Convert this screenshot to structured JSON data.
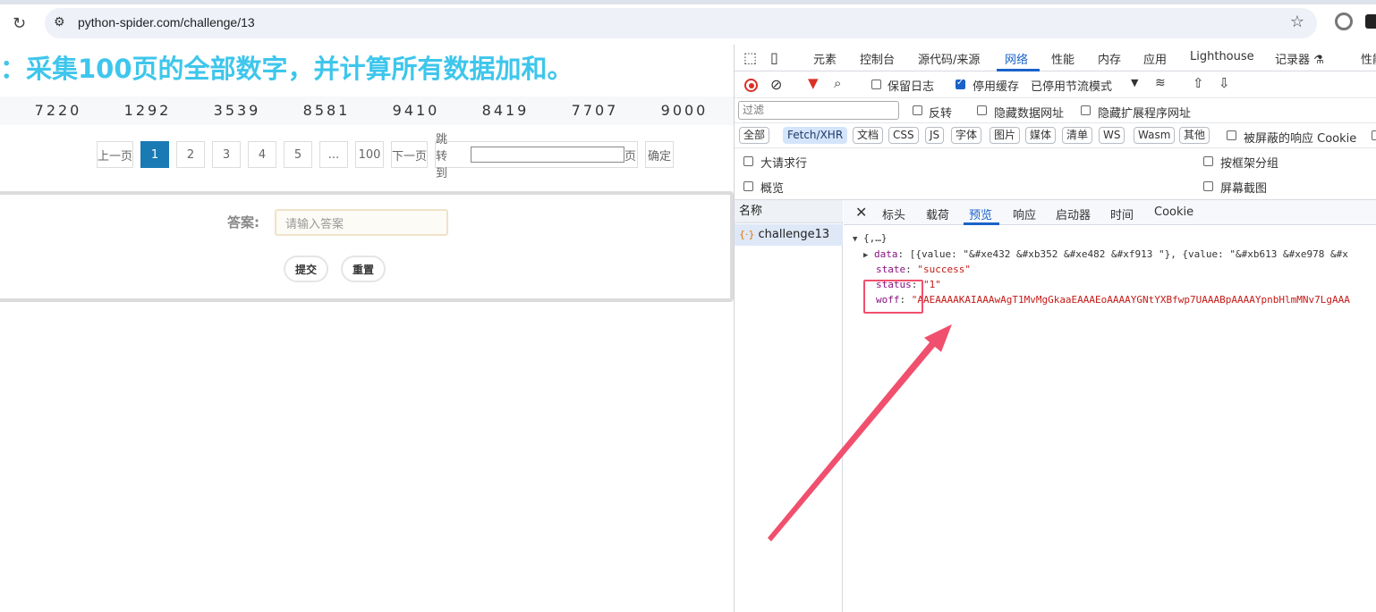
{
  "browser": {
    "url": "python-spider.com/challenge/13"
  },
  "page": {
    "title": "：采集100页的全部数字，并计算所有数据加和。",
    "numbers": [
      "7220",
      "1292",
      "3539",
      "8581",
      "9410",
      "8419",
      "7707",
      "9000"
    ],
    "pagination": {
      "prev": "上一页",
      "pages": [
        "1",
        "2",
        "3",
        "4",
        "5",
        "...",
        "100"
      ],
      "active_page": "1",
      "next": "下一页",
      "jump_to": "跳转到",
      "page_suffix": "页",
      "confirm": "确定"
    },
    "answer": {
      "label": "答案:",
      "placeholder": "请输入答案",
      "submit": "提交",
      "reset": "重置"
    }
  },
  "devtools": {
    "tabs": [
      "元素",
      "控制台",
      "源代码/来源",
      "网络",
      "性能",
      "内存",
      "应用",
      "Lighthouse",
      "记录器 ⚗",
      "性能"
    ],
    "active_tab": "网络",
    "toolbar1": {
      "preserve_log": "保留日志",
      "disable_cache": "停用缓存",
      "throttle": "已停用节流模式"
    },
    "toolbar2": {
      "filter_placeholder": "过滤",
      "invert": "反转",
      "hide_data_urls": "隐藏数据网址",
      "hide_extension_urls": "隐藏扩展程序网址"
    },
    "type_filters": [
      "全部",
      "Fetch/XHR",
      "文档",
      "CSS",
      "JS",
      "字体",
      "图片",
      "媒体",
      "清单",
      "WS",
      "Wasm",
      "其他"
    ],
    "active_type": "Fetch/XHR",
    "blocked_cookies": "被屏蔽的响应 Cookie",
    "options": {
      "large_rows": "大请求行",
      "group_by_frame": "按框架分组",
      "overview": "概览",
      "screenshots": "屏幕截图"
    },
    "name_header": "名称",
    "request_name": "challenge13",
    "detail_tabs": [
      "标头",
      "载荷",
      "预览",
      "响应",
      "启动器",
      "时间",
      "Cookie"
    ],
    "active_detail_tab": "预览",
    "preview": {
      "root": "{,…}",
      "data_key": "data",
      "data_value": "[{value: \"&#xe432 &#xb352 &#xe482 &#xf913 \"}, {value: \"&#xb613 &#xe978 &#x",
      "state_key": "state",
      "state_value": "\"success\"",
      "status_key": "status",
      "status_value": "\"1\"",
      "woff_key": "woff",
      "woff_value": "\"AAEAAAAKAIAAAwAgT1MvMgGkaaEAAAEoAAAAYGNtYXBfwp7UAAABpAAAAYpnbHlmMNv7LgAAA"
    },
    "accent_color": "#1a62c9",
    "annotation_color": "#f0506e"
  }
}
